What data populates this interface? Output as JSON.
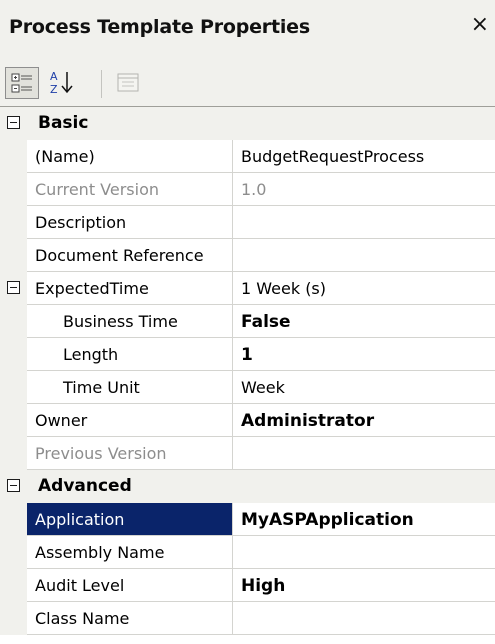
{
  "window": {
    "title": "Process Template Properties",
    "close_glyph": "×"
  },
  "toolbar": {
    "buttons": [
      {
        "icon": "categorized-icon",
        "pressed": true
      },
      {
        "icon": "alphabetical-sort-icon",
        "pressed": false
      },
      {
        "icon": "property-pages-icon",
        "pressed": false,
        "disabled": true
      }
    ]
  },
  "grid": {
    "basic": {
      "label": "Basic",
      "name": {
        "name": "(Name)",
        "value": "BudgetRequestProcess"
      },
      "current_version": {
        "name": "Current Version",
        "value": "1.0"
      },
      "description": {
        "name": "Description",
        "value": ""
      },
      "document_reference": {
        "name": "Document Reference",
        "value": ""
      },
      "expected_time": {
        "name": "ExpectedTime",
        "value": "1 Week (s)"
      },
      "business_time": {
        "name": "Business Time",
        "value": "False"
      },
      "length": {
        "name": "Length",
        "value": "1"
      },
      "time_unit": {
        "name": "Time Unit",
        "value": "Week"
      },
      "owner": {
        "name": "Owner",
        "value": "Administrator"
      },
      "previous_version": {
        "name": "Previous Version",
        "value": ""
      }
    },
    "advanced": {
      "label": "Advanced",
      "application": {
        "name": "Application",
        "value": "MyASPApplication"
      },
      "assembly_name": {
        "name": "Assembly Name",
        "value": ""
      },
      "audit_level": {
        "name": "Audit Level",
        "value": "High"
      },
      "class_name": {
        "name": "Class Name",
        "value": ""
      }
    }
  },
  "colors": {
    "chrome": "#f1f1ed",
    "selection": "#0a246a",
    "disabled_text": "#8d8d8d",
    "grid_line": "#d4d4d0"
  }
}
